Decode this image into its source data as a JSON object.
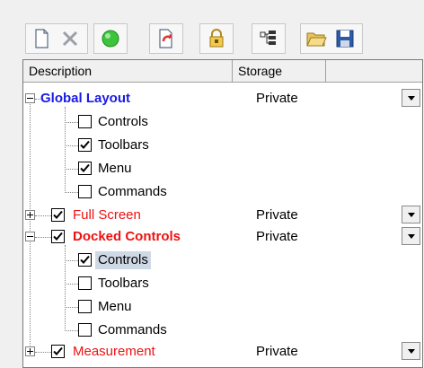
{
  "toolbar": {
    "buttons": [
      "new-icon",
      "delete-icon",
      "green-circle-icon",
      "reset-icon",
      "lock-icon",
      "tree-icon",
      "open-folder-icon",
      "save-icon"
    ]
  },
  "columns": {
    "description": "Description",
    "storage": "Storage"
  },
  "rows": [
    {
      "label": "Global Layout",
      "storage": "Private"
    },
    {
      "label": "Controls"
    },
    {
      "label": "Toolbars"
    },
    {
      "label": "Menu"
    },
    {
      "label": "Commands"
    },
    {
      "label": "Full Screen",
      "storage": "Private"
    },
    {
      "label": "Docked Controls",
      "storage": "Private"
    },
    {
      "label": "Controls"
    },
    {
      "label": "Toolbars"
    },
    {
      "label": "Menu"
    },
    {
      "label": "Commands"
    },
    {
      "label": "Measurement",
      "storage": "Private"
    }
  ],
  "colors": {
    "blue": "#1a1ae6",
    "red": "#ee1111",
    "selection": "#cfd9e6"
  }
}
